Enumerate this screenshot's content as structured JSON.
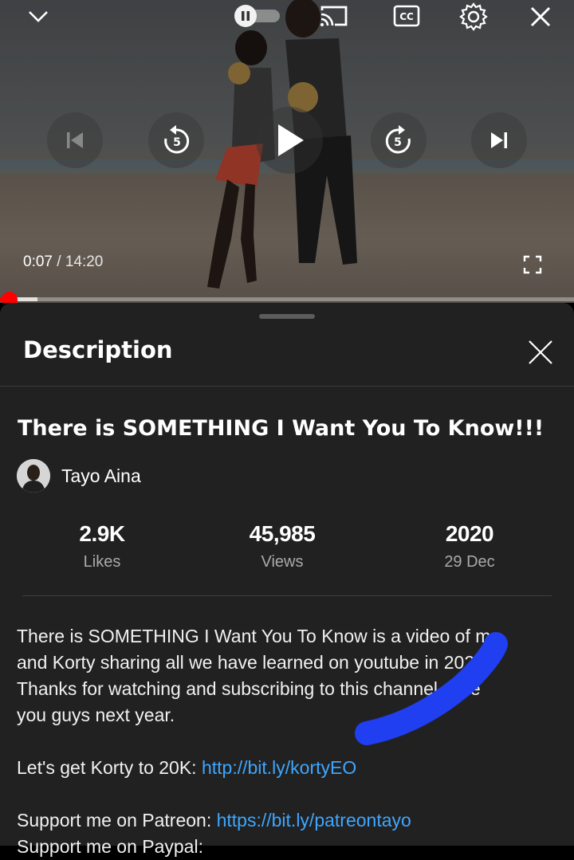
{
  "player": {
    "current_time": "0:07",
    "separator": "/",
    "duration": "14:20",
    "progress_fraction": 0.0082,
    "buffer_fraction": 0.065,
    "icons": [
      "chevron-down-icon",
      "autoplay-toggle",
      "cast-icon",
      "captions-icon",
      "gear-icon",
      "close-icon",
      "previous-icon",
      "rewind-5-icon",
      "play-icon",
      "forward-5-icon",
      "next-icon",
      "fullscreen-icon"
    ],
    "rewind_label": "5",
    "forward_label": "5",
    "cc_label": "CC"
  },
  "sheet": {
    "title": "Description",
    "video_title": "There is SOMETHING I Want You To Know!!!",
    "channel_name": "Tayo Aina",
    "stats": [
      {
        "value": "2.9K",
        "label": "Likes"
      },
      {
        "value": "45,985",
        "label": "Views"
      },
      {
        "value": "2020",
        "label": "29 Dec"
      }
    ],
    "description": {
      "paragraph1_line1": "There is SOMETHING I Want You To Know is a video of me",
      "paragraph1_line2": "and Korty sharing all we have learned on youtube in 2020.",
      "paragraph1_line3": "Thanks for watching and subscribing to this channel. See",
      "paragraph1_line4": "you guys next year.",
      "korty_prefix": "Let's get Korty to 20K: ",
      "korty_link": "http://bit.ly/kortyEO",
      "patreon_prefix": "Support me on Patreon: ",
      "patreon_link": "https://bit.ly/patreontayo",
      "paypal_prefix": "Support me on Paypal:"
    }
  },
  "colors": {
    "accent_red": "#ff0000",
    "link_blue": "#3ea6ff",
    "sheet_bg": "#212121",
    "scribble": "#1f3ff0"
  }
}
